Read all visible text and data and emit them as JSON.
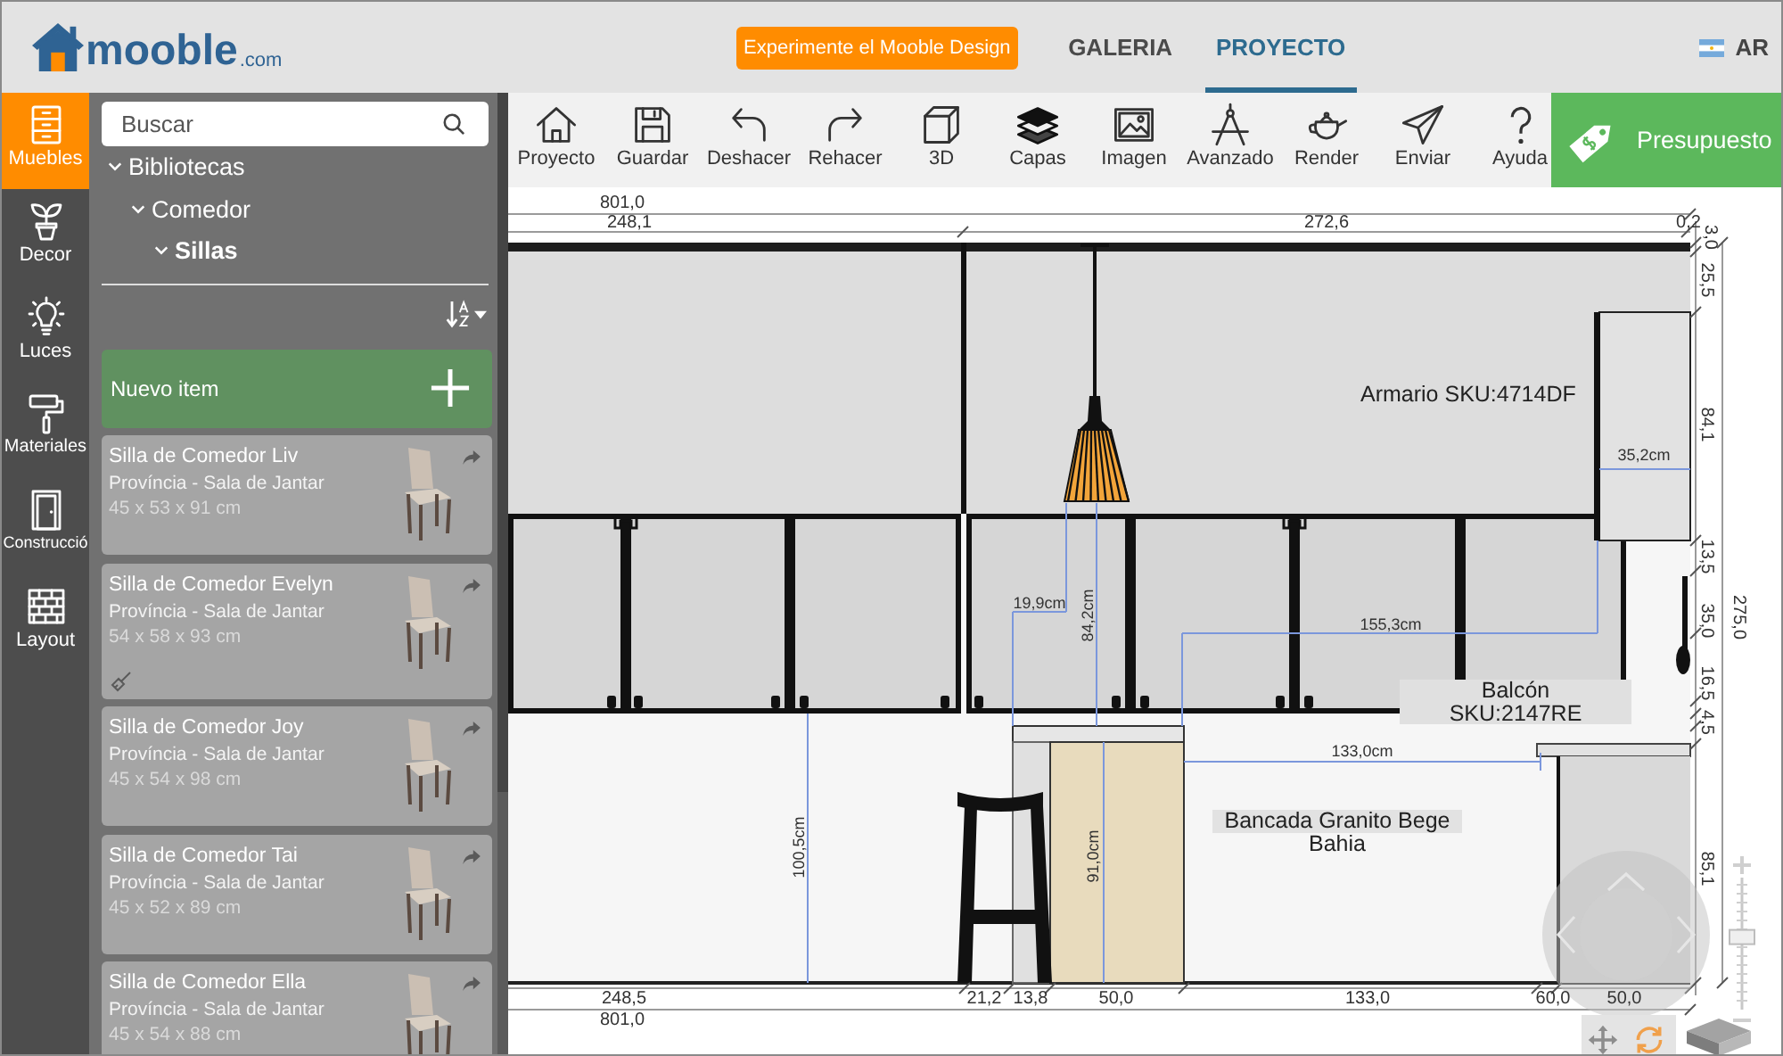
{
  "header": {
    "logo": {
      "name": "mooble",
      "suffix": ".com"
    },
    "promo_button": "Experimente el Mooble Design",
    "nav": [
      {
        "label": "GALERIA",
        "selected": false
      },
      {
        "label": "PROYECTO",
        "selected": true
      }
    ],
    "language": "AR"
  },
  "categories": [
    {
      "label": "Muebles",
      "kind": "furniture",
      "selected": true
    },
    {
      "label": "Decor",
      "kind": "decor",
      "selected": false
    },
    {
      "label": "Luces",
      "kind": "lights",
      "selected": false
    },
    {
      "label": "Materiales",
      "kind": "materials",
      "selected": false
    },
    {
      "label": "Construcció",
      "kind": "construction",
      "selected": false
    },
    {
      "label": "Layout",
      "kind": "layout",
      "selected": false
    }
  ],
  "library": {
    "search": {
      "placeholder": "Buscar"
    },
    "tree": [
      {
        "label": "Bibliotecas",
        "expanded": true,
        "selected": false,
        "children": [
          {
            "label": "Comedor",
            "expanded": true,
            "selected": false,
            "children": [
              {
                "label": "Sillas",
                "expanded": true,
                "selected": true
              }
            ]
          }
        ]
      }
    ],
    "new_item": "Nuevo item",
    "items": [
      {
        "title": "Silla de Comedor Liv",
        "subtitle": "Província - Sala de Jantar",
        "size": "45 x 53 x 91 cm",
        "paintable": false
      },
      {
        "title": "Silla de Comedor Evelyn",
        "subtitle": "Província - Sala de Jantar",
        "size": "54 x 58 x 93 cm",
        "paintable": true
      },
      {
        "title": "Silla de Comedor Joy",
        "subtitle": "Província - Sala de Jantar",
        "size": "45 x 54 x 98 cm",
        "paintable": false
      },
      {
        "title": "Silla de Comedor Tai",
        "subtitle": "Província - Sala de Jantar",
        "size": "45 x 52 x 89 cm",
        "paintable": false
      },
      {
        "title": "Silla de Comedor Ella",
        "subtitle": "Província - Sala de Jantar",
        "size": "45 x 54 x 88 cm",
        "paintable": false
      }
    ]
  },
  "toolbar": {
    "tools": [
      {
        "label": "Proyecto",
        "kind": "home"
      },
      {
        "label": "Guardar",
        "kind": "save"
      },
      {
        "label": "Deshacer",
        "kind": "undo"
      },
      {
        "label": "Rehacer",
        "kind": "redo"
      },
      {
        "label": "3D",
        "kind": "cube"
      },
      {
        "label": "Capas",
        "kind": "layers"
      },
      {
        "label": "Imagen",
        "kind": "image"
      },
      {
        "label": "Avanzado",
        "kind": "compass"
      },
      {
        "label": "Render",
        "kind": "teapot"
      },
      {
        "label": "Enviar",
        "kind": "send"
      },
      {
        "label": "Ayuda",
        "kind": "help"
      }
    ],
    "budget_button": "Presupuesto"
  },
  "canvas": {
    "top_dimensions": [
      "801,0",
      "248,1",
      "272,6",
      "0,2"
    ],
    "side_dimensions": [
      "3,0",
      "25,5",
      "84,1",
      "13,5",
      "35,0",
      "16,5",
      "4,5",
      "85,1",
      "275,0"
    ],
    "bottom_dimensions": [
      "248,5",
      "21,2",
      "13,8",
      "50,0",
      "133,0",
      "60,0",
      "50,0",
      "801,0"
    ],
    "measurements": [
      "35,2cm",
      "19,9cm",
      "84,2cm",
      "155,3cm",
      "133,0cm",
      "100,5cm",
      "91,0cm"
    ],
    "labels": [
      {
        "text": "Armario SKU:4714DF",
        "kind": "plain"
      },
      {
        "text": "Balcón SKU:2147RE",
        "kind": "boxed"
      },
      {
        "text": "Bancada Granito Bege Bahia",
        "kind": "highlighted"
      }
    ],
    "zoom_slider": {
      "level": 0.55
    }
  }
}
